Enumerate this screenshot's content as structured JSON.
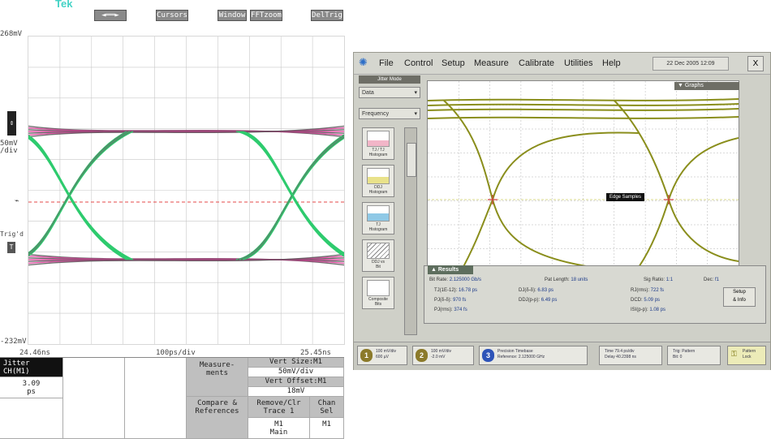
{
  "tek": {
    "logo": "Tek",
    "toolbar": [
      "◄══►",
      "Cursors",
      "Window",
      "FFTzoom",
      "DelTrig"
    ],
    "y_top": "268mV",
    "y_bottom": "-232mV",
    "y_scale": "50mV\n/div",
    "x_left": "24.46ns",
    "x_center": "100ps/div",
    "x_right": "25.45ns",
    "trig_label": "Trig'd",
    "table": {
      "jitter_title": "Jitter\nCH(M1)",
      "jitter_value": "3.09\nps",
      "measurements": "Measure-\nments",
      "vert_size_title": "Vert Size:M1",
      "vert_size_value": "50mV/div",
      "vert_offset_title": "Vert Offset:M1",
      "vert_offset_value": "18mV",
      "compare": "Compare &\nReferences",
      "remove_clr": "Remove/Clr\nTrace 1",
      "remove_value": "M1\nMain",
      "chan_sel": "Chan\nSel",
      "chan_value": "M1"
    },
    "colors": {
      "green": "#2ecb6e",
      "magenta": "#e0389a",
      "grid": "#c8c8c8",
      "ref": "#e64a4a"
    }
  },
  "dca": {
    "menu": [
      "File",
      "Control",
      "Setup",
      "Measure",
      "Calibrate",
      "Utilities",
      "Help"
    ],
    "datetime": "22 Dec 2005  12:09",
    "close": "X",
    "jitter_mode": "Jitter Mode",
    "dropdown1": "Data",
    "dropdown2": "Frequency",
    "side_buttons": [
      "TJ / TJ\nHistogram",
      "DDJ\nHistogram",
      "TJ\nHistogram",
      "DDJ vs\nBit",
      "Composite\nBits"
    ],
    "graph_title": "Graphs",
    "edge_label": "Edge Samples",
    "results": {
      "title": "Results",
      "bit_rate_label": "Bit Rate:",
      "bit_rate": "2.125000 Gb/s",
      "pat_len_label": "Pat Length:",
      "pat_len": "18 units",
      "sig_ratio_label": "Sig Ratio:",
      "sig_ratio": "1:1",
      "dec_label": "Dec:",
      "dec": "f1",
      "rows": [
        [
          "TJ(1E-12):",
          "16.78 ps",
          "DJ(δ-δ):",
          "6.83 ps",
          "RJ(rms):",
          "722 fs"
        ],
        [
          "PJ(δ-δ):",
          "970 fs",
          "DDJ(p-p):",
          "6.49 ps",
          "DCD:",
          "5.09 ps"
        ],
        [
          "PJ(rms):",
          "374 fs",
          "",
          "",
          "ISI(p-p):",
          "1.08 ps"
        ]
      ],
      "setup": "Setup\n& Info"
    },
    "bottom": [
      {
        "num": "1",
        "color": "#8b7a2a",
        "text": "100 mV/div\n600 µV"
      },
      {
        "num": "2",
        "color": "#8b7a2a",
        "text": "100 mV/div\n-2.0 mV"
      },
      {
        "num": "3",
        "color": "#2e54b8",
        "text": "Precision Timebase\nReference: 2.125000 GHz"
      },
      {
        "num": "",
        "color": "#8b7a2a",
        "text": "Time 79.4 ps/div\nDelay 40.2398 ns"
      },
      {
        "num": "",
        "color": "#8b7a2a",
        "text": "Trig: Pattern\nBit: 0"
      },
      {
        "num": "",
        "color": "#bfb23a",
        "text": "Pattern\nLock"
      }
    ],
    "colors": {
      "trace": "#8a8e1c",
      "grid": "#b4b4b4",
      "frame": "#cfd0c8"
    }
  }
}
